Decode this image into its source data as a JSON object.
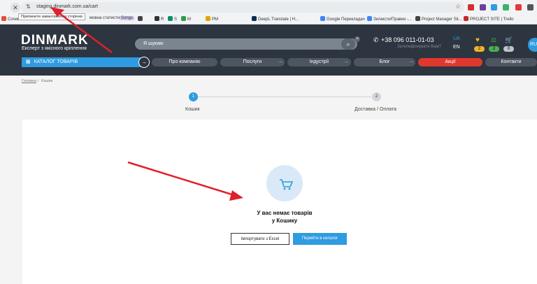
{
  "browser": {
    "url": "staging.dinmark.com.ua/cart",
    "tooltip": "Припинити завантаження сторінки",
    "bookmarks": [
      "Сочинки",
      "Songs",
      "R",
      "S",
      "M",
      "PM",
      "DeepL Translate | H...",
      "Google Перекладач",
      "Зе/нисти/Правки -...",
      "Project Manager Sit...",
      "PROJECT SITE | Trello"
    ],
    "bookmark_partial": "мовна статистика",
    "colors": {
      "accent": "#2f9be0",
      "arrow": "#e0202a"
    }
  },
  "header": {
    "logo": "DINMARK",
    "logo_sub": "Експерт з якісного кріплення",
    "search_placeholder": "Я шукаю",
    "phone": "+38 096 011-01-03",
    "callback": "Зателефонувати Вам?",
    "lang_ua": "UA",
    "lang_en": "EN",
    "lang_ru": "RU",
    "badges": {
      "favorites": "2",
      "compare": "2",
      "cart": "0"
    }
  },
  "nav": {
    "catalog": "КАТАЛОГ ТОВАРІВ",
    "items": [
      "Про компанію",
      "Послуги",
      "Індустрії",
      "Блог",
      "Акції",
      "Контакти"
    ]
  },
  "breadcrumb": {
    "home": "Головна",
    "sep": "/",
    "current": "Кошик"
  },
  "steps": [
    {
      "num": "1",
      "label": "Кошик"
    },
    {
      "num": "2",
      "label": "Доставка / Оплата"
    }
  ],
  "cart": {
    "empty_line1": "У вас немає товарів",
    "empty_line2": "у Кошику",
    "import_btn": "Імпортувати з Excel",
    "catalog_btn": "Перейти в каталог"
  }
}
